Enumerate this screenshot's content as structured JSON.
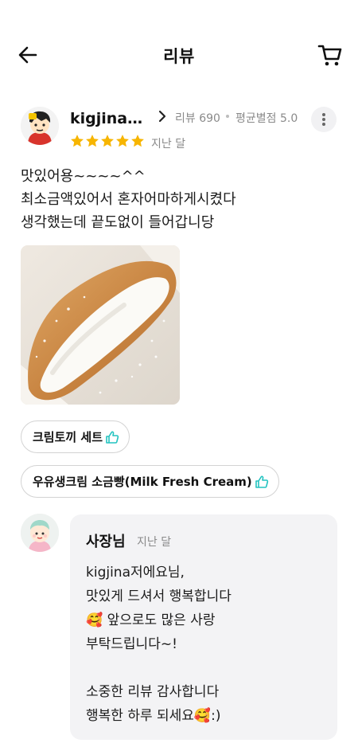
{
  "header": {
    "title": "리뷰",
    "back_icon": "arrow-left-icon",
    "cart_icon": "cart-icon"
  },
  "review": {
    "reviewer_name": "kigjina저…",
    "review_count_label": "리뷰 690",
    "avg_rating_label": "평균별점 5.0",
    "rating": 5,
    "date": "지난 달",
    "text": "맛있어용~~~~^^\n최소금액있어서 혼자어마하게시켰다\n생각했는데 끝도없이 들어갑니당",
    "menu_items": [
      {
        "label": "크림토끼 세트"
      },
      {
        "label": "우유생크림 소금빵(Milk Fresh Cream)"
      }
    ]
  },
  "reply": {
    "owner_name": "사장님",
    "date": "지난 달",
    "text": "kigjina저에요님,\n맛있게 드셔서 행복합니다\n🥰 앞으로도 많은 사랑\n부탁드립니다~!\n\n소중한 리뷰 감사합니다\n행복한 하루 되세요🥰:)"
  },
  "colors": {
    "star": "#F7B500",
    "thumb": "#22C3C0",
    "reply_bg": "#F3F3F5",
    "muted": "#8A8A8A"
  }
}
